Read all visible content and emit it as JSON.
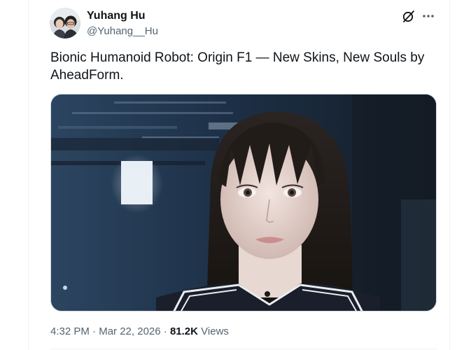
{
  "author": {
    "display_name": "Yuhang Hu",
    "handle": "@Yuhang__Hu"
  },
  "icons": {
    "avatar": "profile-photo",
    "grok": "grok-icon",
    "more": "more-horizontal-icon"
  },
  "tweet": {
    "text": "Bionic Humanoid Robot: Origin F1 — New Skins, New Souls by AheadForm."
  },
  "meta": {
    "time": "4:32 PM",
    "separator": "·",
    "date": "Mar 22, 2026",
    "views_count": "81.2K",
    "views_label": "Views"
  },
  "colors": {
    "primary_text": "#0f1419",
    "secondary_text": "#536471",
    "border": "#cfd9de"
  }
}
